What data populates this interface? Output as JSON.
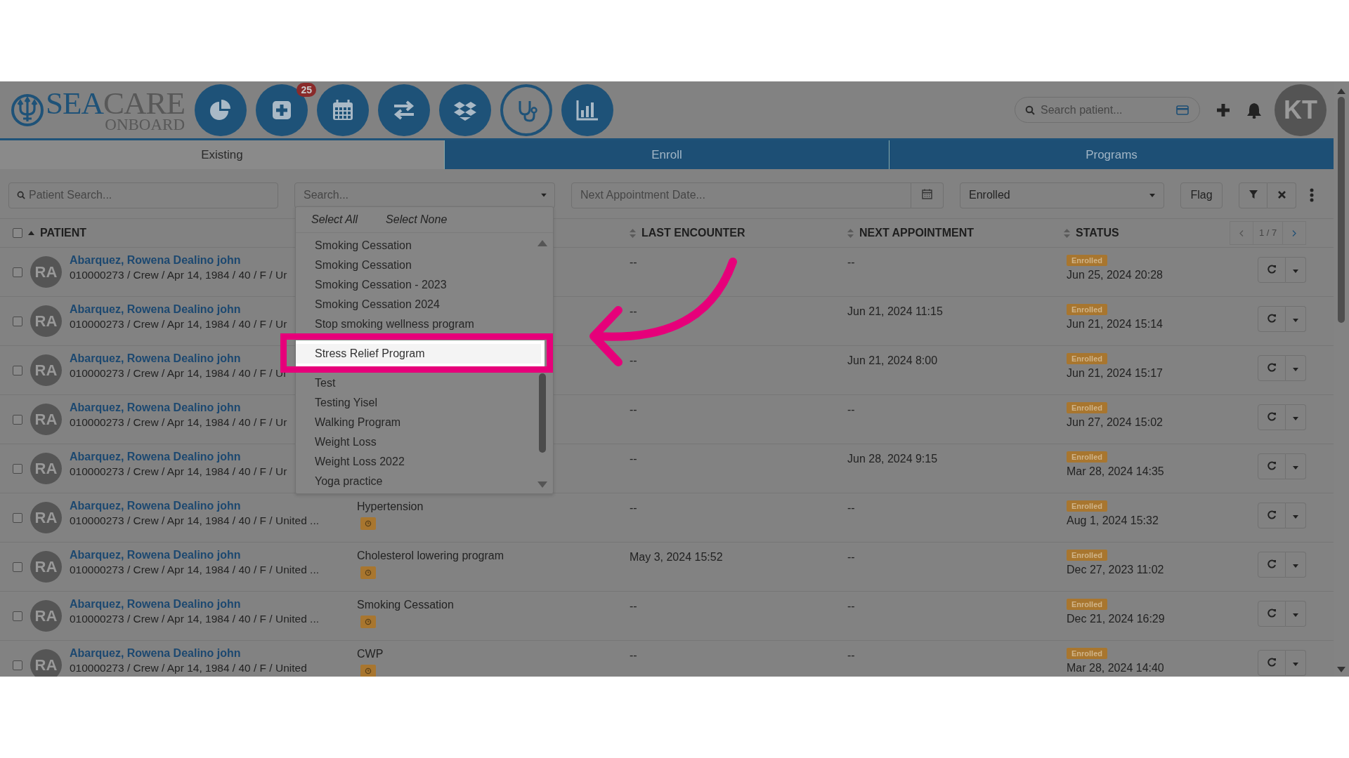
{
  "logo": {
    "part_1": "SEA",
    "part_2": "CARE",
    "subtitle": "ONBOARD"
  },
  "nav_items": [
    {
      "selected": false
    },
    {
      "selected": false,
      "badge": "25"
    },
    {
      "selected": false
    },
    {
      "selected": false
    },
    {
      "selected": false
    },
    {
      "selected": true
    },
    {
      "selected": false
    }
  ],
  "patient_lookup": {
    "placeholder": "Search patient..."
  },
  "user": {
    "initials": "KT"
  },
  "tabs": [
    {
      "label": "Existing",
      "selected": true
    },
    {
      "label": "Enroll",
      "selected": false
    },
    {
      "label": "Programs",
      "selected": false
    }
  ],
  "filters": {
    "patient_search": {
      "placeholder": "Patient Search..."
    },
    "program_select": {
      "placeholder": "Search..."
    },
    "next_appointment": {
      "placeholder": "Next Appointment Date..."
    },
    "status_select": {
      "value": "Enrolled"
    },
    "flag_button": "Flag"
  },
  "program_dropdown": {
    "select_all": "Select All",
    "select_none": "Select None",
    "items": [
      {
        "label": "Smoking Cessation",
        "highlighted": false
      },
      {
        "label": "Smoking Cessation",
        "highlighted": false
      },
      {
        "label": "Smoking Cessation - 2023",
        "highlighted": false
      },
      {
        "label": "Smoking Cessation 2024",
        "highlighted": false
      },
      {
        "label": "Stop smoking wellness program",
        "highlighted": false
      },
      {
        "label": "Stress Relief Program",
        "highlighted": true
      },
      {
        "label": "Test",
        "highlighted": false
      },
      {
        "label": "Testing Yisel",
        "highlighted": false
      },
      {
        "label": "Walking Program",
        "highlighted": false
      },
      {
        "label": "Weight Loss",
        "highlighted": false
      },
      {
        "label": "Weight Loss 2022",
        "highlighted": false
      },
      {
        "label": "Yoga practice",
        "highlighted": false
      }
    ]
  },
  "table": {
    "select_all_checked": false,
    "columns": [
      {
        "label": "PATIENT",
        "sorted": true
      },
      {
        "label": "LAST ENCOUNTER",
        "sorted": false
      },
      {
        "label": "NEXT APPOINTMENT",
        "sorted": false
      },
      {
        "label": "STATUS",
        "sorted": false
      }
    ],
    "pagination": "1 / 7",
    "rows": [
      {
        "checked": false,
        "initials": "RA",
        "name": "Abarquez, Rowena Dealino john",
        "details": "010000273 / Crew / Apr 14, 1984 / 40 / F / Ur",
        "last_encounter": "--",
        "next_appointment": "--",
        "status": "Enrolled",
        "status_date": "Jun 25, 2024 20:28"
      },
      {
        "checked": false,
        "initials": "RA",
        "name": "Abarquez, Rowena Dealino john",
        "details": "010000273 / Crew / Apr 14, 1984 / 40 / F / Ur",
        "last_encounter": "--",
        "next_appointment": "Jun 21, 2024 11:15",
        "status": "Enrolled",
        "status_date": "Jun 21, 2024 15:14"
      },
      {
        "checked": false,
        "initials": "RA",
        "name": "Abarquez, Rowena Dealino john",
        "details": "010000273 / Crew / Apr 14, 1984 / 40 / F / Ur",
        "last_encounter": "--",
        "next_appointment": "Jun 21, 2024 8:00",
        "status": "Enrolled",
        "status_date": "Jun 21, 2024 15:17"
      },
      {
        "checked": false,
        "initials": "RA",
        "name": "Abarquez, Rowena Dealino john",
        "details": "010000273 / Crew / Apr 14, 1984 / 40 / F / Ur",
        "last_encounter": "--",
        "next_appointment": "--",
        "status": "Enrolled",
        "status_date": "Jun 27, 2024 15:02"
      },
      {
        "checked": false,
        "initials": "RA",
        "name": "Abarquez, Rowena Dealino john",
        "details": "010000273 / Crew / Apr 14, 1984 / 40 / F / Ur",
        "last_encounter": "--",
        "next_appointment": "Jun 28, 2024 9:15",
        "status": "Enrolled",
        "status_date": "Mar 28, 2024 14:35"
      },
      {
        "checked": false,
        "initials": "RA",
        "name": "Abarquez, Rowena Dealino john",
        "details": "010000273 / Crew / Apr 14, 1984 / 40 / F / United ...",
        "program": "Hypertension",
        "program_icon": true,
        "last_encounter": "--",
        "next_appointment": "--",
        "status": "Enrolled",
        "status_date": "Aug 1, 2024 15:32"
      },
      {
        "checked": false,
        "initials": "RA",
        "name": "Abarquez, Rowena Dealino john",
        "details": "010000273 / Crew / Apr 14, 1984 / 40 / F / United ...",
        "program": "Cholesterol lowering program",
        "program_icon": true,
        "last_encounter": "May 3, 2024 15:52",
        "next_appointment": "--",
        "status": "Enrolled",
        "status_date": "Dec 27, 2023 11:02"
      },
      {
        "checked": false,
        "initials": "RA",
        "name": "Abarquez, Rowena Dealino john",
        "details": "010000273 / Crew / Apr 14, 1984 / 40 / F / United ...",
        "program": "Smoking Cessation",
        "program_icon": true,
        "last_encounter": "--",
        "next_appointment": "--",
        "status": "Enrolled",
        "status_date": "Dec 21, 2024 16:29"
      },
      {
        "checked": false,
        "initials": "RA",
        "name": "Abarquez, Rowena Dealino john",
        "details": "010000273 / Crew / Apr 14, 1984 / 40 / F / United",
        "program": "CWP",
        "program_icon": true,
        "last_encounter": "--",
        "next_appointment": "--",
        "status": "Enrolled",
        "status_date": "Mar 28, 2024 14:40"
      }
    ]
  }
}
